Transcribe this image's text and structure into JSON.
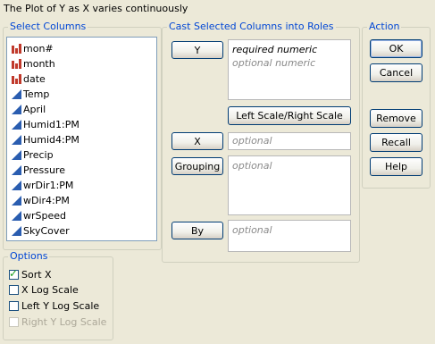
{
  "window": {
    "title": "The Plot of Y as X varies continuously"
  },
  "select_columns": {
    "label": "Select Columns",
    "items": [
      {
        "label": "mon#",
        "type": "nominal"
      },
      {
        "label": "month",
        "type": "nominal"
      },
      {
        "label": "date",
        "type": "nominal"
      },
      {
        "label": "Temp",
        "type": "continuous"
      },
      {
        "label": "April",
        "type": "continuous"
      },
      {
        "label": "Humid1:PM",
        "type": "continuous"
      },
      {
        "label": "Humid4:PM",
        "type": "continuous"
      },
      {
        "label": "Precip",
        "type": "continuous"
      },
      {
        "label": "Pressure",
        "type": "continuous"
      },
      {
        "label": "wrDir1:PM",
        "type": "continuous"
      },
      {
        "label": "wDir4:PM",
        "type": "continuous"
      },
      {
        "label": "wrSpeed",
        "type": "continuous"
      },
      {
        "label": "SkyCover",
        "type": "continuous"
      }
    ]
  },
  "roles": {
    "label": "Cast Selected Columns into Roles",
    "y_button": "Y",
    "y_required": "required numeric",
    "y_optional": "optional numeric",
    "scale_button": "Left Scale/Right Scale",
    "x_button": "X",
    "x_placeholder": "optional",
    "grouping_button": "Grouping",
    "grouping_placeholder": "optional",
    "by_button": "By",
    "by_placeholder": "optional"
  },
  "action": {
    "label": "Action",
    "ok": "OK",
    "cancel": "Cancel",
    "remove": "Remove",
    "recall": "Recall",
    "help": "Help"
  },
  "options": {
    "label": "Options",
    "sort_x": {
      "label": "Sort X",
      "checked": true
    },
    "x_log": {
      "label": "X Log Scale",
      "checked": false
    },
    "left_y_log": {
      "label": "Left Y Log Scale",
      "checked": false
    },
    "right_y_log": {
      "label": "Right Y Log Scale",
      "checked": false,
      "disabled": true
    }
  },
  "colors": {
    "nominal_icon": "#c0392b",
    "continuous_icon": "#2a5db0",
    "group_label": "#0046d5"
  }
}
